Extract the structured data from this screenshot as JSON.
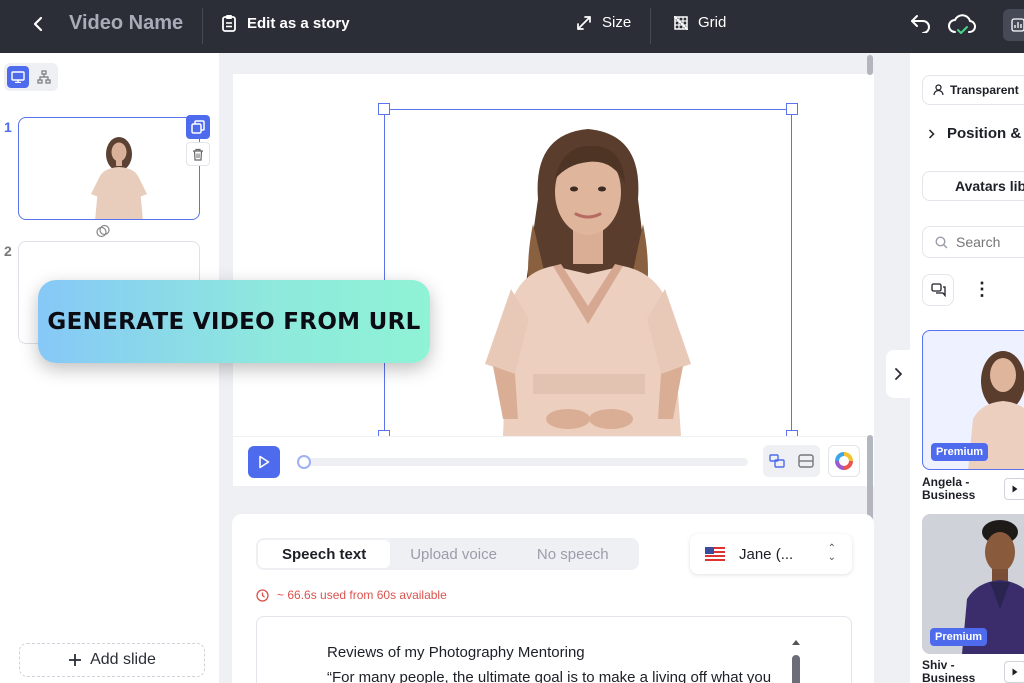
{
  "topbar": {
    "title": "Video Name",
    "story_label": "Edit as a story",
    "size_label": "Size",
    "grid_label": "Grid"
  },
  "slides": {
    "items": [
      {
        "number": "1",
        "selected": true
      },
      {
        "number": "2",
        "selected": false
      }
    ],
    "add_label": "Add slide"
  },
  "banner": {
    "text": "GENERATE VIDEO FROM URL"
  },
  "speech": {
    "tabs": [
      {
        "label": "Speech text",
        "active": true
      },
      {
        "label": "Upload voice",
        "active": false
      },
      {
        "label": "No speech",
        "active": false
      }
    ],
    "voice_label": "Jane (...",
    "usage_text": "~ 66.6s used from 60s available",
    "lines": [
      "Reviews of my Photography Mentoring",
      "“For many people, the ultimate goal is to make a living off what you"
    ]
  },
  "right_panel": {
    "background_label": "Transparent",
    "position_label": "Position & C",
    "library_label": "Avatars lib",
    "search_placeholder": "Search",
    "avatars": [
      {
        "name": "Angela - Business",
        "badge": "Premium"
      },
      {
        "name": "Shiv - Business",
        "badge": "Premium"
      }
    ]
  },
  "colors": {
    "accent": "#4f6bed",
    "topbar": "#2b2d37",
    "warning": "#d9534f"
  }
}
